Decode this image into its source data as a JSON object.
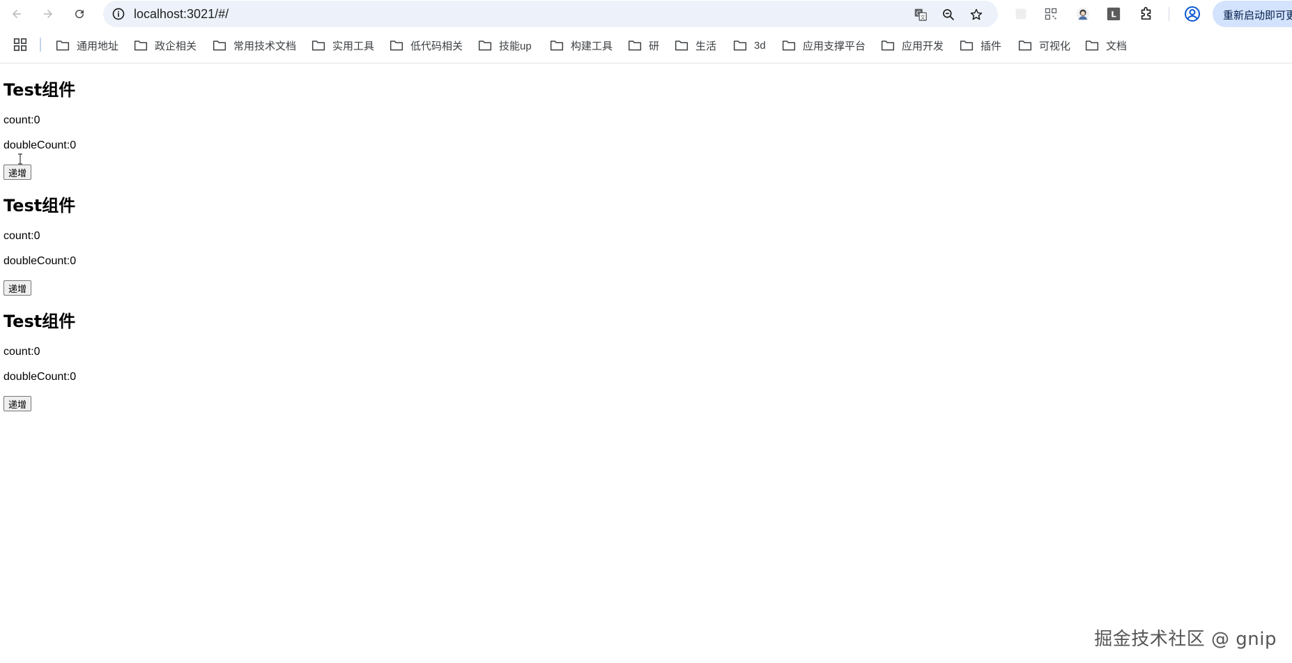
{
  "browser": {
    "url": "localhost:3021/#/",
    "relaunch_label": "重新启动即可更新"
  },
  "bookmarks": [
    {
      "label": "通用地址"
    },
    {
      "label": "政企相关"
    },
    {
      "label": "常用技术文档"
    },
    {
      "label": "实用工具"
    },
    {
      "label": "低代码相关"
    },
    {
      "label": "技能up"
    },
    {
      "label": "构建工具"
    },
    {
      "label": "研"
    },
    {
      "label": "生活"
    },
    {
      "label": "3d"
    },
    {
      "label": "应用支撑平台"
    },
    {
      "label": "应用开发"
    },
    {
      "label": "插件"
    },
    {
      "label": "可视化"
    },
    {
      "label": "文档"
    }
  ],
  "components": [
    {
      "title": "Test组件",
      "count": "count:0",
      "double_count": "doubleCount:0",
      "button_label": "递增"
    },
    {
      "title": "Test组件",
      "count": "count:0",
      "double_count": "doubleCount:0",
      "button_label": "递增"
    },
    {
      "title": "Test组件",
      "count": "count:0",
      "double_count": "doubleCount:0",
      "button_label": "递增"
    }
  ],
  "watermark": "掘金技术社区 @ gnip",
  "icons": {
    "back": "arrow-left-icon",
    "forward": "arrow-right-icon",
    "reload": "reload-icon",
    "site_info": "info-icon",
    "translate": "translate-icon",
    "zoom": "zoom-out-icon",
    "bookmark": "star-icon",
    "profile": "profile-icon",
    "extensions": "puzzle-icon"
  },
  "colors": {
    "omnibox_bg": "#edf2fa",
    "relaunch_bg": "#d3e3fd"
  }
}
